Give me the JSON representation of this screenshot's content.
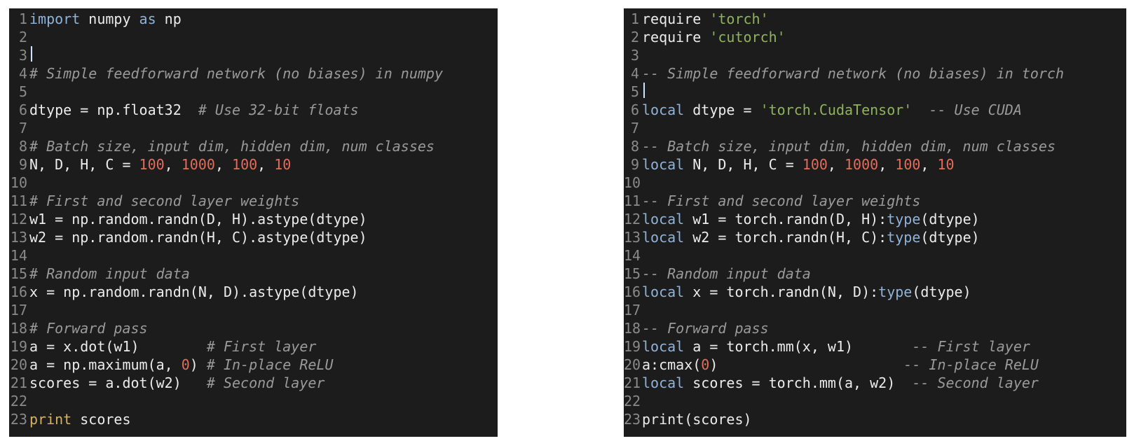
{
  "left_editor": {
    "language": "python",
    "lines": [
      {
        "n": "1"
      },
      {
        "n": "2"
      },
      {
        "n": "3"
      },
      {
        "n": "4",
        "comment": "# Simple feedforward network (no biases) in numpy"
      },
      {
        "n": "5"
      },
      {
        "n": "6",
        "code": "dtype = np.float32  ",
        "comment": "# Use 32-bit floats"
      },
      {
        "n": "7"
      },
      {
        "n": "8",
        "comment": "# Batch size, input dim, hidden dim, num classes"
      },
      {
        "n": "9"
      },
      {
        "n": "10"
      },
      {
        "n": "11",
        "comment": "# First and second layer weights"
      },
      {
        "n": "12",
        "code": "w1 = np.random.randn(D, H).astype(dtype)"
      },
      {
        "n": "13",
        "code": "w2 = np.random.randn(H, C).astype(dtype)"
      },
      {
        "n": "14"
      },
      {
        "n": "15",
        "comment": "# Random input data"
      },
      {
        "n": "16",
        "code": "x = np.random.randn(N, D).astype(dtype)"
      },
      {
        "n": "17"
      },
      {
        "n": "18",
        "comment": "# Forward pass"
      },
      {
        "n": "19",
        "code": "a = x.dot(w1)        ",
        "comment": "# First layer"
      },
      {
        "n": "20"
      },
      {
        "n": "21",
        "code": "scores = a.dot(w2)   ",
        "comment": "# Second layer"
      },
      {
        "n": "22"
      },
      {
        "n": "23"
      }
    ],
    "tokens": {
      "l1_import": "import",
      "l1_numpy": " numpy ",
      "l1_as": "as",
      "l1_np": " np",
      "l9_vars": "N, D, H, C = ",
      "l9_n1": "100",
      "l9_sep1": ", ",
      "l9_n2": "1000",
      "l9_sep2": ", ",
      "l9_n3": "100",
      "l9_sep3": ", ",
      "l9_n4": "10",
      "l20_a": "a = np.maximum(a, ",
      "l20_zero": "0",
      "l20_close": ") ",
      "l20_comment": "# In-place ReLU",
      "l23_print": "print",
      "l23_scores": " scores"
    }
  },
  "right_editor": {
    "language": "lua",
    "tokens": {
      "l1_require": "require ",
      "l1_str": "'torch'",
      "l2_require": "require ",
      "l2_str": "'cutorch'",
      "l4_comment": "-- Simple feedforward network (no biases) in torch",
      "l6_local": "local",
      "l6_mid": " dtype = ",
      "l6_str": "'torch.CudaTensor'",
      "l6_comment": "  -- Use CUDA",
      "l8_comment": "-- Batch size, input dim, hidden dim, num classes",
      "l9_local": "local",
      "l9_vars": " N, D, H, C = ",
      "l9_n1": "100",
      "l9_n2": "1000",
      "l9_n3": "100",
      "l9_n4": "10",
      "l11_comment": "-- First and second layer weights",
      "l12_local": "local",
      "l12_code": " w1 = torch.randn(D, H):",
      "l12_type": "type",
      "l12_end": "(dtype)",
      "l13_local": "local",
      "l13_code": " w2 = torch.randn(H, C):",
      "l13_type": "type",
      "l13_end": "(dtype)",
      "l15_comment": "-- Random input data",
      "l16_local": "local",
      "l16_code": " x = torch.randn(N, D):",
      "l16_type": "type",
      "l16_end": "(dtype)",
      "l18_comment": "-- Forward pass",
      "l19_local": "local",
      "l19_code": " a = torch.mm(x, w1)       ",
      "l19_comment": "-- First layer",
      "l20_code": "a:cmax(",
      "l20_zero": "0",
      "l20_close": ")                      ",
      "l20_comment": "-- In-place ReLU",
      "l21_local": "local",
      "l21_code": " scores = torch.mm(a, w2)  ",
      "l21_comment": "-- Second layer",
      "l23_print": "print",
      "l23_args": "(scores)"
    }
  },
  "colors": {
    "editor_bg": "#1c1c1c",
    "text": "#ececec",
    "line_number": "#8a8a8a",
    "keyword": "#8fb3d9",
    "number": "#e36c5a",
    "string": "#8fb35c",
    "comment": "#9a9a9a",
    "cursor": "#cfe2ff"
  }
}
